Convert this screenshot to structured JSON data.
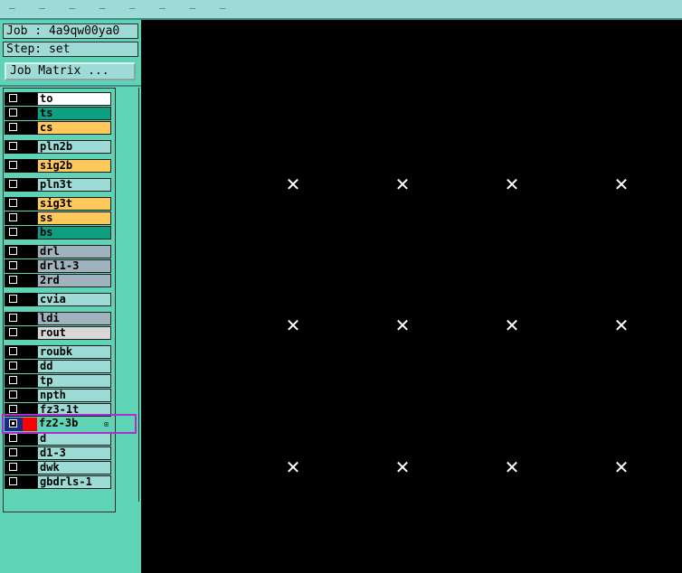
{
  "info": {
    "job": "Job : 4a9qw00ya0",
    "step": "Step: set"
  },
  "job_matrix_button": "Job Matrix ...",
  "expander_symbol": "⊞",
  "marker_symbol": "✕",
  "layers": [
    {
      "name": "to",
      "color": "#ffffff",
      "checked": false
    },
    {
      "name": "ts",
      "color": "#0e9e80",
      "checked": false
    },
    {
      "name": "cs",
      "color": "#ffc85a",
      "checked": false
    },
    {
      "name": "pln2b",
      "color": "#9edbd6",
      "checked": false
    },
    {
      "name": "sig2b",
      "color": "#ffc85a",
      "checked": false
    },
    {
      "name": "pln3t",
      "color": "#9edbd6",
      "checked": false
    },
    {
      "name": "sig3t",
      "color": "#ffc85a",
      "checked": false
    },
    {
      "name": "ss",
      "color": "#ffc85a",
      "checked": false
    },
    {
      "name": "bs",
      "color": "#0e9e80",
      "checked": false
    },
    {
      "name": "drl",
      "color": "#9fb2bd",
      "checked": false
    },
    {
      "name": "drl1-3",
      "color": "#9fb2bd",
      "checked": false
    },
    {
      "name": "2rd",
      "color": "#9fb2bd",
      "checked": false
    },
    {
      "name": "cvia",
      "color": "#9edbd6",
      "checked": false
    },
    {
      "name": "ldi",
      "color": "#9fb2bd",
      "checked": false
    },
    {
      "name": "rout",
      "color": "#d8d8d8",
      "checked": false
    },
    {
      "name": "roubk",
      "color": "#9edbd6",
      "checked": false
    },
    {
      "name": "dd",
      "color": "#9edbd6",
      "checked": false
    },
    {
      "name": "tp",
      "color": "#9edbd6",
      "checked": false
    },
    {
      "name": "npth",
      "color": "#9edbd6",
      "checked": false
    },
    {
      "name": "fz3-1t",
      "color": "#9edbd6",
      "checked": false
    },
    {
      "name": "fz2-3b",
      "color": "#5fd3b6",
      "checked": true,
      "selected": true
    },
    {
      "name": "d",
      "color": "#9edbd6",
      "checked": false
    },
    {
      "name": "d1-3",
      "color": "#9edbd6",
      "checked": false
    },
    {
      "name": "dwk",
      "color": "#9edbd6",
      "checked": false
    },
    {
      "name": "gbdrls-1",
      "color": "#9edbd6",
      "checked": false
    }
  ]
}
